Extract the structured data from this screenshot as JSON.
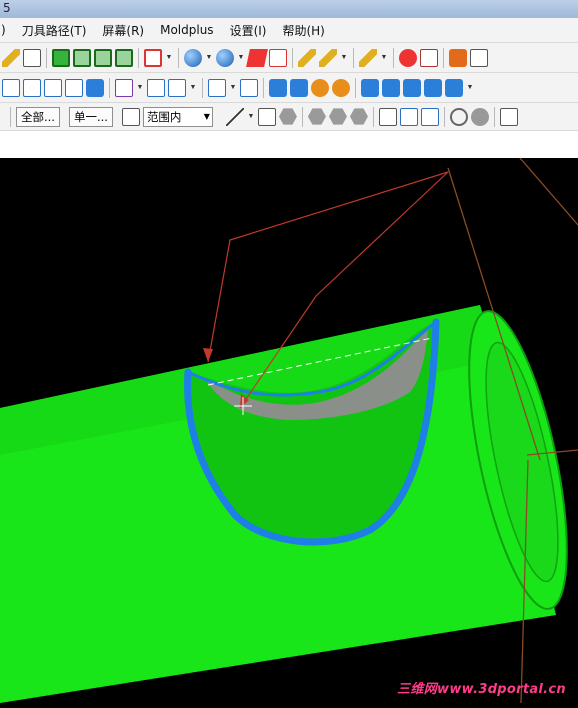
{
  "window": {
    "title_fragment": "5"
  },
  "menubar": {
    "items": [
      ")",
      "刀具路径(T)",
      "屏幕(R)",
      "Moldplus",
      "设置(I)",
      "帮助(H)"
    ]
  },
  "toolbar3": {
    "all_button": "全部...",
    "single_button": "单一...",
    "range_select": "范围内"
  },
  "watermark": "三维网www.3dportal.cn",
  "colors": {
    "model": "#19e619",
    "edge_highlight": "#1e7fe6",
    "construction_lines": "#c0392b",
    "axis_lines": "#8a4b24",
    "background": "#000000"
  }
}
